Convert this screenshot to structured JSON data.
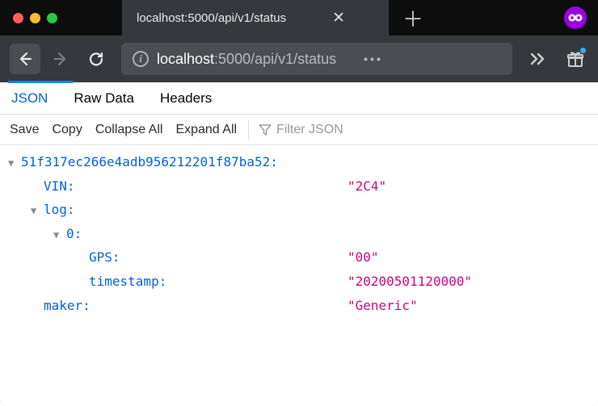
{
  "window": {
    "tab_title": "localhost:5000/api/v1/status"
  },
  "nav": {
    "url_host": "localhost",
    "url_path": ":5000/api/v1/status"
  },
  "viewer": {
    "tabs": {
      "json": "JSON",
      "raw": "Raw Data",
      "headers": "Headers"
    },
    "toolbar": {
      "save": "Save",
      "copy": "Copy",
      "collapse_all": "Collapse All",
      "expand_all": "Expand All",
      "filter_placeholder": "Filter JSON"
    }
  },
  "json": {
    "root_key": "51f317ec266e4adb956212201f87ba52:",
    "vin_key": "VIN:",
    "vin_val": "\"2C4\"",
    "log_key": "log:",
    "idx0_key": "0:",
    "gps_key": "GPS:",
    "gps_val": "\"00\"",
    "ts_key": "timestamp:",
    "ts_val": "\"20200501120000\"",
    "maker_key": "maker:",
    "maker_val": "\"Generic\""
  }
}
